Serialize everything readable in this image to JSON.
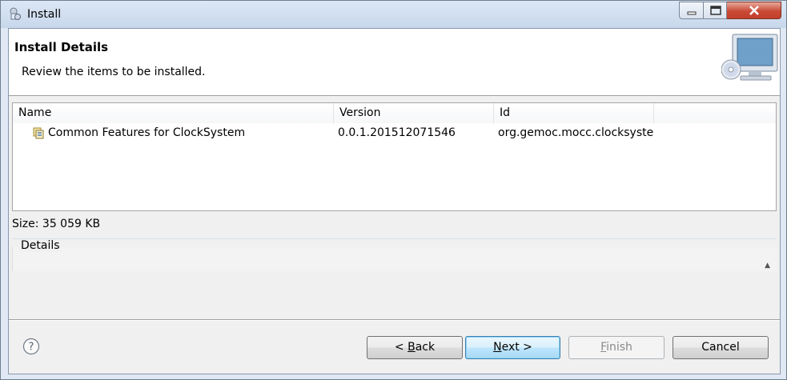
{
  "window": {
    "title": "Install"
  },
  "header": {
    "title": "Install Details",
    "description": "Review the items to be installed."
  },
  "table": {
    "columns": [
      "Name",
      "Version",
      "Id"
    ],
    "rows": [
      {
        "name": "Common Features for ClockSystem",
        "version": "0.0.1.201512071546",
        "id": "org.gemoc.mocc.clocksyste..."
      }
    ]
  },
  "size_label": "Size: 35 059 KB",
  "details_label": "Details",
  "buttons": {
    "back": {
      "prefix": "< ",
      "mnemonic": "B",
      "rest": "ack"
    },
    "next": {
      "mnemonic": "N",
      "rest": "ext >"
    },
    "finish": {
      "mnemonic": "F",
      "rest": "inish",
      "enabled": false
    },
    "cancel": "Cancel"
  },
  "icons": {
    "app": "install-wizard-icon",
    "header": "computer-cd-icon",
    "feature": "feature-icon",
    "help": "help-icon"
  }
}
